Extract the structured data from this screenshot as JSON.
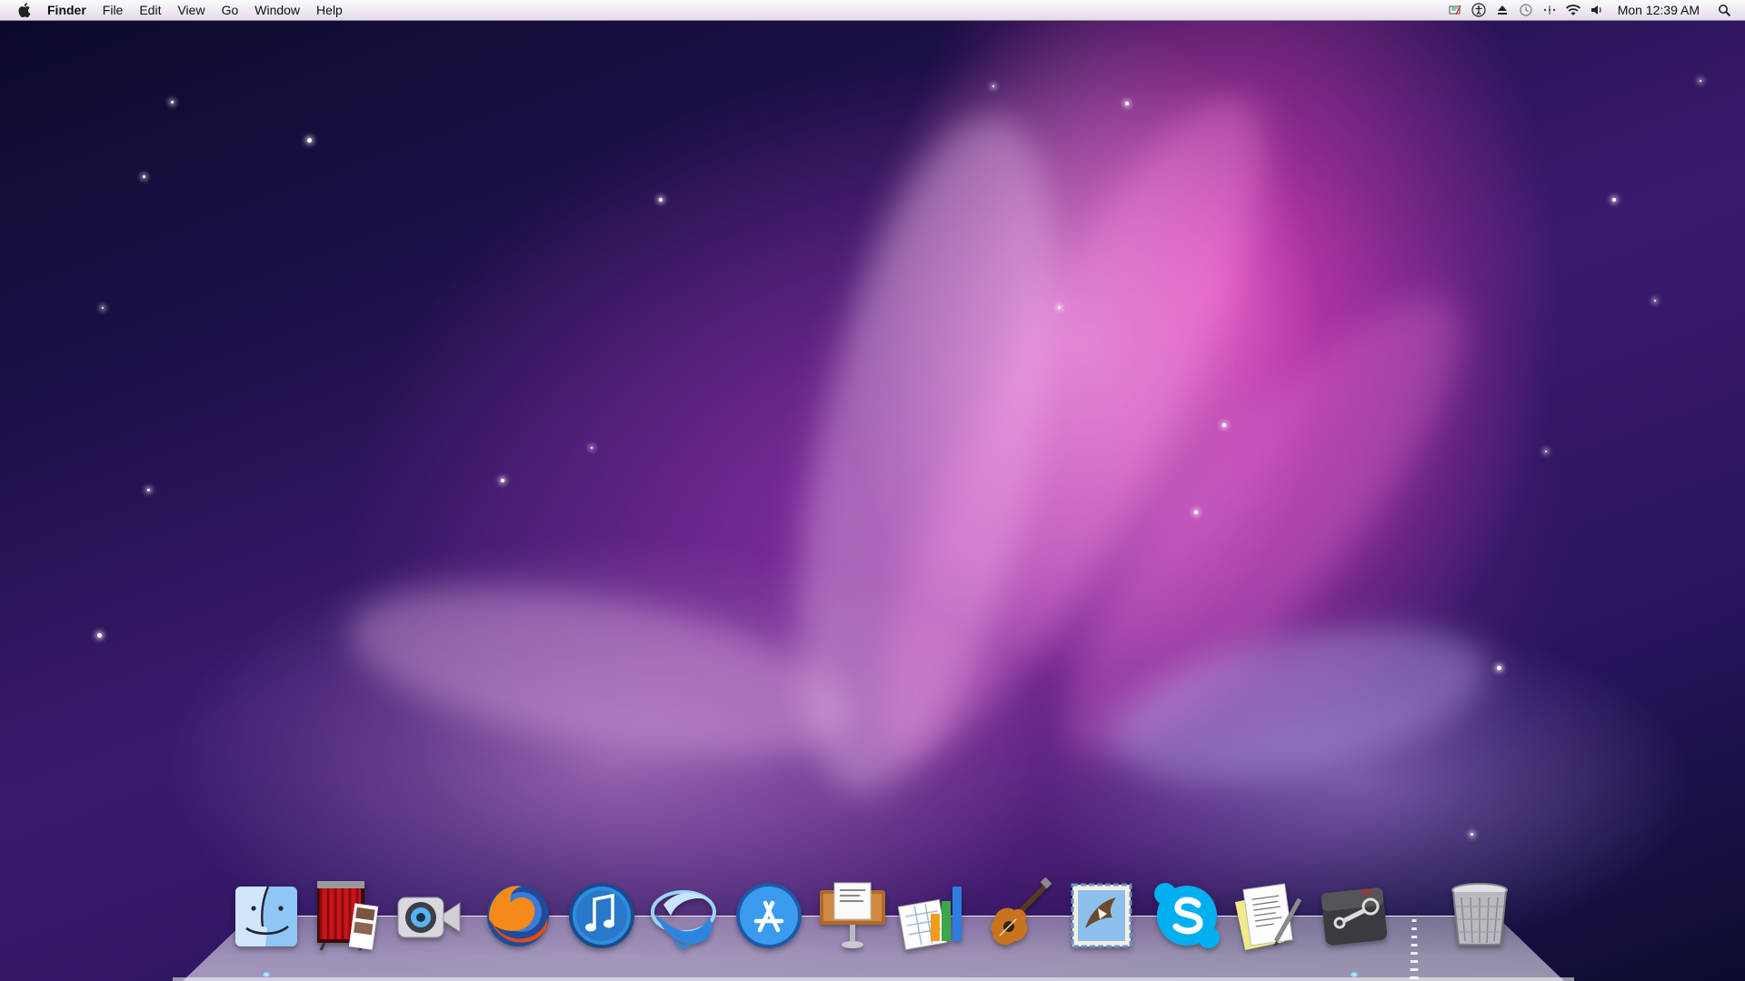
{
  "menubar": {
    "apple_icon": "apple-logo-icon",
    "app_name": "Finder",
    "menus": [
      "File",
      "Edit",
      "View",
      "Go",
      "Window",
      "Help"
    ],
    "status_icons": [
      "input-method-icon",
      "accessibility-icon",
      "eject-icon",
      "time-machine-icon",
      "bluetooth-dots-icon",
      "wifi-icon",
      "volume-icon"
    ],
    "clock": "Mon 12:39 AM",
    "search_icon": "spotlight-search-icon"
  },
  "dock": {
    "apps": [
      {
        "name": "Finder",
        "icon": "finder-icon"
      },
      {
        "name": "Photo Booth",
        "icon": "photo-booth-icon"
      },
      {
        "name": "FaceTime",
        "icon": "facetime-icon"
      },
      {
        "name": "Firefox",
        "icon": "firefox-icon"
      },
      {
        "name": "iTunes",
        "icon": "itunes-icon"
      },
      {
        "name": "Safari-like",
        "icon": "swirl-app-icon"
      },
      {
        "name": "App Store",
        "icon": "app-store-icon"
      },
      {
        "name": "Keynote",
        "icon": "keynote-icon"
      },
      {
        "name": "Numbers",
        "icon": "numbers-icon"
      },
      {
        "name": "GarageBand",
        "icon": "garageband-icon"
      },
      {
        "name": "Mail",
        "icon": "mail-icon"
      },
      {
        "name": "Skype",
        "icon": "skype-icon"
      },
      {
        "name": "TextEdit",
        "icon": "textedit-icon"
      },
      {
        "name": "Steam",
        "icon": "steam-icon"
      }
    ],
    "trash": {
      "name": "Trash",
      "icon": "trash-icon"
    },
    "running": [
      "Finder",
      "Steam"
    ]
  },
  "colors": {
    "menubar_top": "#fbfbfd",
    "menubar_bottom": "#e5dbe9",
    "wallpaper_accent": "#e840bc",
    "wallpaper_deep": "#1c1048"
  }
}
